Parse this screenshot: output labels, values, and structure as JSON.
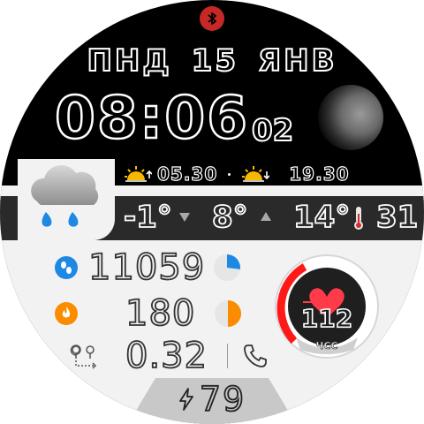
{
  "status": {
    "bluetooth_icon": "bluetooth-icon",
    "bluetooth_color": "#c62828"
  },
  "date": {
    "day_of_week": "ПНД",
    "day": "15",
    "month": "ЯНВ"
  },
  "time": {
    "hours_minutes": "08:06",
    "seconds": "02"
  },
  "moon": {
    "icon": "moon-phase-icon"
  },
  "sun": {
    "sunrise": "05.30",
    "sunset": "19.30"
  },
  "weather": {
    "icon": "cloud-rain-icon",
    "current_temp": "-1°",
    "min_temp": "8°",
    "max_temp": "14°",
    "humidity": "31"
  },
  "stats": {
    "steps": {
      "value": "11059",
      "progress": 0.27,
      "color": "#1e88e5"
    },
    "calories": {
      "value": "180",
      "progress": 0.5,
      "color": "#fb8c00"
    },
    "distance": {
      "value": "0.32"
    }
  },
  "heart": {
    "value": "112",
    "label": "ЧСС",
    "accent": "#ff1a1a"
  },
  "battery": {
    "value": "79"
  }
}
